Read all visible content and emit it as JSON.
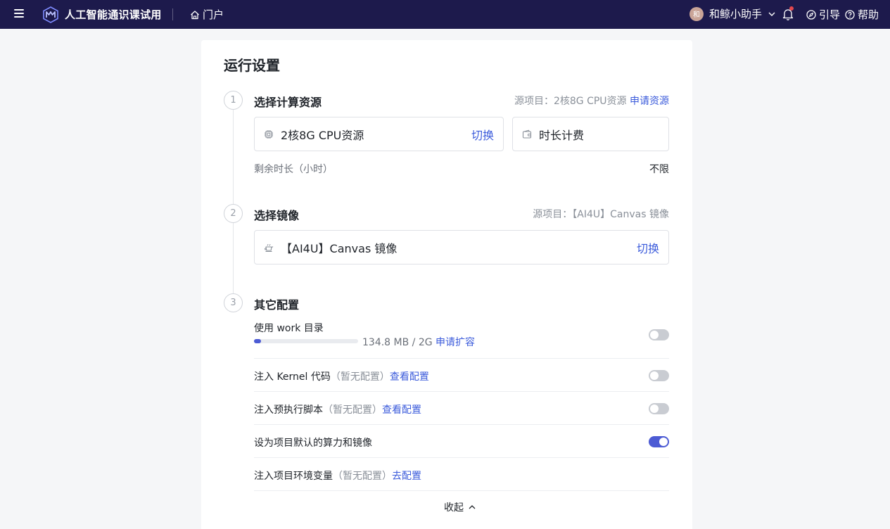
{
  "header": {
    "app_title": "人工智能通识课试用",
    "portal_label": "门户",
    "avatar_text": "和",
    "user_name": "和鲸小助手",
    "guide_label": "引导",
    "help_label": "帮助"
  },
  "page": {
    "title": "运行设置"
  },
  "steps": [
    {
      "num": "1",
      "title": "选择计算资源",
      "meta_prefix": "源项目：2核8G CPU资源",
      "meta_link": "申请资源",
      "resource": "2核8G CPU资源",
      "switch_label": "切换",
      "billing": "时长计费",
      "remain_label": "剩余时长（小时）",
      "remain_value": "不限"
    },
    {
      "num": "2",
      "title": "选择镜像",
      "meta": "源项目：【AI4U】Canvas 镜像",
      "image": "【AI4U】Canvas 镜像",
      "switch_label": "切换"
    },
    {
      "num": "3",
      "title": "其它配置"
    }
  ],
  "config": {
    "work_dir": {
      "label": "使用 work 目录",
      "usage_fraction": 0.067,
      "usage_text": "134.8 MB / 2G",
      "usage_link": "申请扩容",
      "enabled": false
    },
    "items": [
      {
        "label": "注入 Kernel 代码",
        "note": "（暂无配置）",
        "link": "查看配置",
        "enabled": false
      },
      {
        "label": "注入预执行脚本",
        "note": "（暂无配置）",
        "link": "查看配置",
        "enabled": false
      },
      {
        "label": "设为项目默认的算力和镜像",
        "note": "",
        "link": "",
        "enabled": true
      },
      {
        "label": "注入项目环境变量",
        "note": "（暂无配置）",
        "link": "去配置",
        "enabled": null
      }
    ],
    "collapse_label": "收起"
  },
  "colors": {
    "topbar": "#1d1a4c",
    "accent": "#4c5bd4",
    "link": "#3b5bdb",
    "badge": "#e5484d"
  },
  "icons": [
    "menu-icon",
    "logo-icon",
    "home-icon",
    "chevron-down-icon",
    "bell-icon",
    "compass-icon",
    "help-icon",
    "chip-icon",
    "wallet-icon",
    "teapot-icon",
    "chevron-up-icon"
  ]
}
